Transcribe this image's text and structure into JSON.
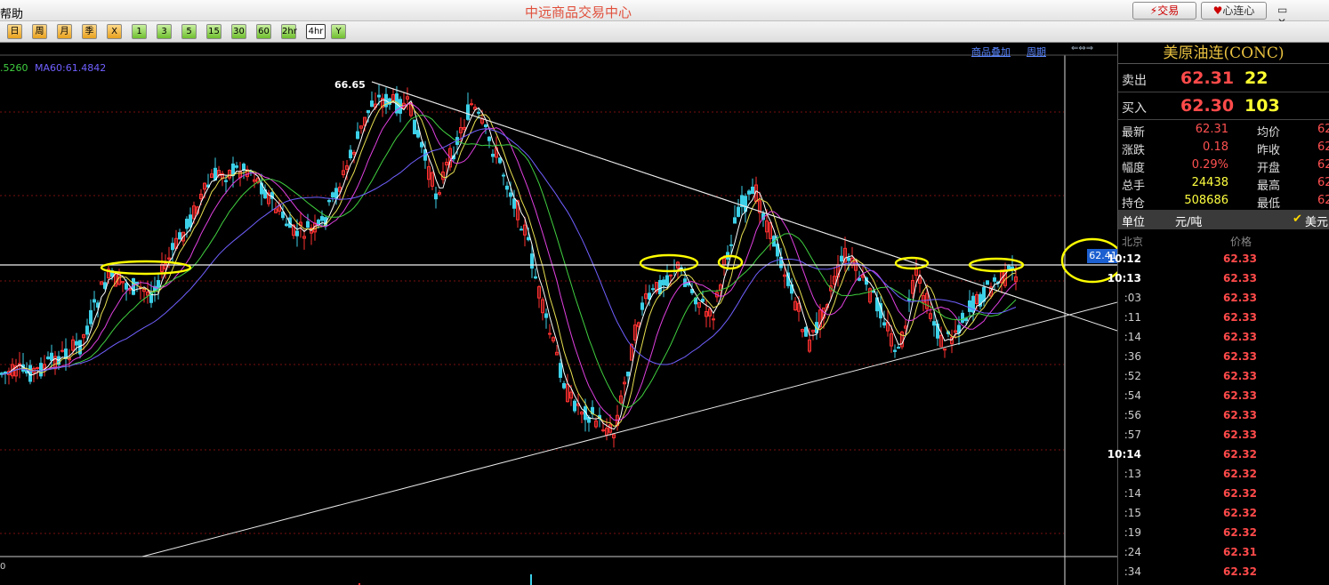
{
  "titlebar": {
    "menu_help": "帮助",
    "app_title": "中远商品交易中心",
    "trade_btn": "交易",
    "xinlian_btn": "心连心",
    "window_controls": "▭ ✕"
  },
  "toolbar": {
    "period_buttons": [
      "日",
      "周",
      "月",
      "季",
      "X",
      "1",
      "3",
      "5",
      "15",
      "30",
      "60",
      "2hr",
      "4hr",
      "Y"
    ],
    "selected": "4hr"
  },
  "chart": {
    "links": [
      "商品叠加",
      "周期"
    ],
    "nav_icons": "⇐⇔⇒",
    "ma_prefix": ".5260",
    "ma60_label": "MA60:61.4842",
    "high_label": "66.65",
    "current_price_tag": "62.41",
    "volume_axis_label": "0",
    "colors": {
      "up": "#ff3030",
      "down": "#3cd0e8",
      "ma5": "#ffffff",
      "ma10": "#e8e050",
      "ma20": "#e040e0",
      "ma30": "#40d040",
      "ma60": "#7060ff",
      "highlight": "#ffff00"
    }
  },
  "quote_panel": {
    "instrument": "美原油连(CONC)",
    "sell": {
      "label": "卖出",
      "price": "62.31",
      "volume": "22"
    },
    "buy": {
      "label": "买入",
      "price": "62.30",
      "volume": "103"
    },
    "stats": [
      {
        "l1": "最新",
        "v1": "62.31",
        "l2": "均价",
        "v2": "62"
      },
      {
        "l1": "涨跌",
        "v1": "0.18",
        "l2": "昨收",
        "v2": "62"
      },
      {
        "l1": "幅度",
        "v1": "0.29%",
        "l2": "开盘",
        "v2": "62"
      },
      {
        "l1": "总手",
        "v1": "24438",
        "l2": "最高",
        "v2": "62"
      },
      {
        "l1": "持仓",
        "v1": "508686",
        "l2": "最低",
        "v2": "62"
      }
    ],
    "unit_label": "单位",
    "unit_value": "元/吨",
    "currency": "美元",
    "tick_header": {
      "time": "北京",
      "price": "价格"
    },
    "ticks": [
      {
        "time": "10:12",
        "price": "62.33"
      },
      {
        "time": "10:13",
        "price": "62.33"
      },
      {
        "time": ":03",
        "price": "62.33"
      },
      {
        "time": ":11",
        "price": "62.33"
      },
      {
        "time": ":14",
        "price": "62.33"
      },
      {
        "time": ":36",
        "price": "62.33"
      },
      {
        "time": ":52",
        "price": "62.33"
      },
      {
        "time": ":54",
        "price": "62.33"
      },
      {
        "time": ":56",
        "price": "62.33"
      },
      {
        "time": ":57",
        "price": "62.33"
      },
      {
        "time": "10:14",
        "price": "62.32"
      },
      {
        "time": ":13",
        "price": "62.32"
      },
      {
        "time": ":14",
        "price": "62.32"
      },
      {
        "time": ":15",
        "price": "62.32"
      },
      {
        "time": ":19",
        "price": "62.32"
      },
      {
        "time": ":24",
        "price": "62.31"
      },
      {
        "time": ":34",
        "price": "62.32"
      }
    ]
  }
}
